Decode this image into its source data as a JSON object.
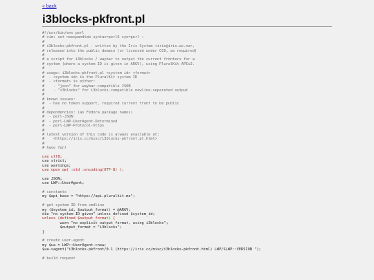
{
  "nav": {
    "back_label": "« back"
  },
  "page": {
    "title": "i3blocks-pkfront.pl"
  },
  "code_lines": [
    {
      "t": "#!/usr/bin/env perl",
      "c": "comment"
    },
    {
      "t": "# vim: set noexpandtab syntax=perl6 syn=perl :",
      "c": "comment"
    },
    {
      "t": "#",
      "c": "comment"
    },
    {
      "t": "# i3blocks-pkfront.pl - written by the Iris System <iris@iris.ac.nz>,",
      "c": "comment"
    },
    {
      "t": "# released into the public domain (or licensed under CC0, as required)",
      "c": "comment"
    },
    {
      "t": "#",
      "c": "comment"
    },
    {
      "t": "# a script for i3blocks / waybar to output the current fronters for a",
      "c": "comment"
    },
    {
      "t": "# system (where a system ID is given in ARGV), using PluralKit APIv2.",
      "c": "comment"
    },
    {
      "t": "#",
      "c": "comment"
    },
    {
      "t": "# usage: i3blocks-pkfront.pl <system id> <format>",
      "c": "comment"
    },
    {
      "t": "#  - <system id> is the PluralKit system ID",
      "c": "comment"
    },
    {
      "t": "#  - <format> is either:",
      "c": "comment"
    },
    {
      "t": "#    - \"json\" for waybar-compatible JSON",
      "c": "comment"
    },
    {
      "t": "#    - \"i3blocks\" for i3blocks-compatible newline-separated output",
      "c": "comment"
    },
    {
      "t": "#",
      "c": "comment"
    },
    {
      "t": "# known issues:",
      "c": "comment"
    },
    {
      "t": "#  - has no token support, required current front to be public",
      "c": "comment"
    },
    {
      "t": "#",
      "c": "comment"
    },
    {
      "t": "# dependencies: (as Fedora package names)",
      "c": "comment"
    },
    {
      "t": "#  - perl-JSON",
      "c": "comment"
    },
    {
      "t": "#  - perl-LWP-UserAgent-Determined",
      "c": "comment"
    },
    {
      "t": "#  - perl-LWP-Protocol-https",
      "c": "comment"
    },
    {
      "t": "#",
      "c": "comment"
    },
    {
      "t": "# latest version of this code is always available at:",
      "c": "comment"
    },
    {
      "t": "#    <https://iris.cc/misc/i3blocks-pkfront.pl.html>",
      "c": "comment"
    },
    {
      "t": "#",
      "c": "comment"
    },
    {
      "t": "# have fun!",
      "c": "comment"
    },
    {
      "t": "",
      "c": "plain"
    },
    {
      "t": "use utf8;",
      "c": "kw"
    },
    {
      "t": "use strict;",
      "c": "plain"
    },
    {
      "t": "use warnings;",
      "c": "plain"
    },
    {
      "t": "use open qw( :std :encoding(UTF-8) );",
      "c": "kw"
    },
    {
      "t": "",
      "c": "plain"
    },
    {
      "t": "use JSON;",
      "c": "plain"
    },
    {
      "t": "use LWP::UserAgent;",
      "c": "plain"
    },
    {
      "t": "",
      "c": "plain"
    },
    {
      "t": "# constants",
      "c": "comment"
    },
    {
      "t": "my $api_base = \"https://api.pluralkit.me\";",
      "c": "plain"
    },
    {
      "t": "",
      "c": "plain"
    },
    {
      "t": "# get system ID from cmdline",
      "c": "comment"
    },
    {
      "t": "my ($system_id, $output_format) = @ARGV;",
      "c": "plain"
    },
    {
      "t": "die \"no system ID given\" unless defined $system_id;",
      "c": "plain"
    },
    {
      "t": "unless (defined $output_format) {",
      "c": "kw"
    },
    {
      "t": "        warn \"no explicit output format, using i3blocks\";",
      "c": "plain"
    },
    {
      "t": "        $output_format = \"i3blocks\";",
      "c": "plain"
    },
    {
      "t": "}",
      "c": "plain"
    },
    {
      "t": "",
      "c": "plain"
    },
    {
      "t": "# create user-agent",
      "c": "comment"
    },
    {
      "t": "my $ua = LWP::UserAgent->new;",
      "c": "plain"
    },
    {
      "t": "$ua->agent(\"i3blocks-pkfront/0.1 (https://iris.cc/misc/i3blocks-pkfront.html) LWP/SLWP::VERSION \");",
      "c": "plain"
    },
    {
      "t": "",
      "c": "plain"
    },
    {
      "t": "# build request",
      "c": "comment"
    }
  ]
}
